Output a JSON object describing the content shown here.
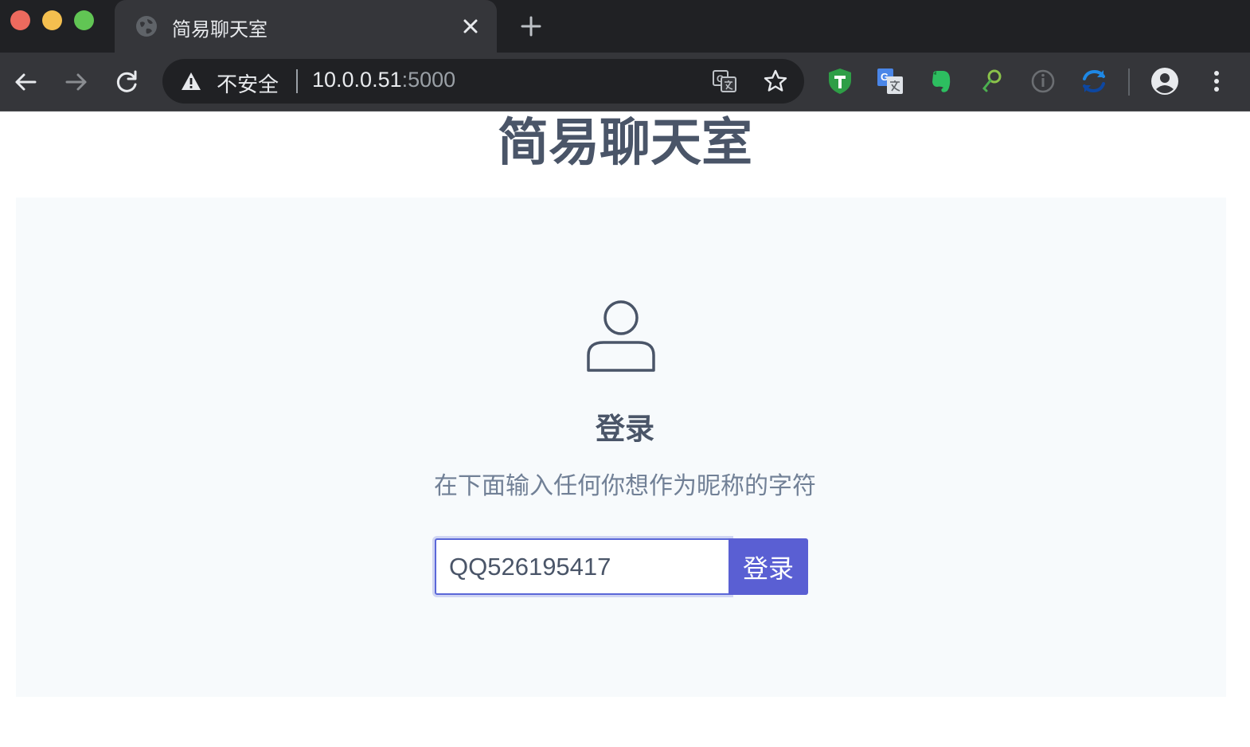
{
  "browser": {
    "tab": {
      "title": "简易聊天室"
    },
    "address": {
      "security_label": "不安全",
      "host": "10.0.0.51",
      "port": ":5000"
    },
    "extensions": [
      "tampermonkey-icon",
      "google-translate-icon",
      "evernote-icon",
      "key-search-icon",
      "info-icon",
      "sync-icon"
    ],
    "colors": {
      "frame": "#202124",
      "toolbar": "#35363a",
      "accent": "#5a67d8"
    }
  },
  "page": {
    "heading": "简易聊天室",
    "login": {
      "title": "登录",
      "hint": "在下面输入任何你想作为昵称的字符",
      "nickname_value": "QQ526195417",
      "button_label": "登录"
    }
  }
}
